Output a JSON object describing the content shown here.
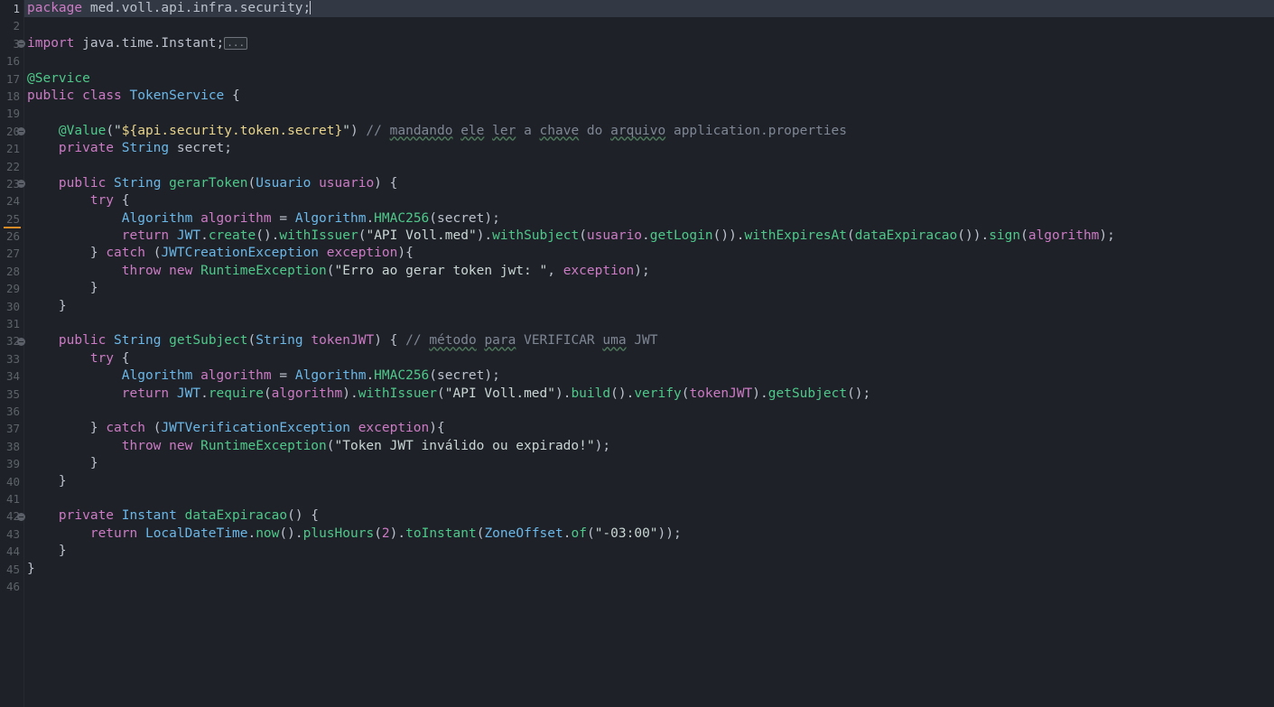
{
  "editor": {
    "language": "java",
    "file_type": "Java source",
    "background_color": "#1e2128",
    "current_line_color": "#323844",
    "gutter_color": "#1e2128",
    "marker_color": "#d98b26",
    "caret_color": "#c8ccd4",
    "first_visible_line": 1,
    "last_visible_line": 46,
    "current_line_number": 1,
    "fold_placeholder": "...",
    "fold_marker_lines": [
      3,
      20,
      23,
      32,
      42
    ],
    "marker_bar_line": 25
  },
  "lines": [
    {
      "num": "1",
      "current": true,
      "caret": true,
      "tokens": [
        {
          "t": "package",
          "c": "kw"
        },
        {
          "t": " med.voll.api.infra.security;",
          "c": "ns"
        }
      ]
    },
    {
      "num": "2",
      "tokens": []
    },
    {
      "num": "3",
      "fold": true,
      "foldbox": true,
      "tokens": [
        {
          "t": "import",
          "c": "kw"
        },
        {
          "t": " java.time.Instant;",
          "c": "ns"
        }
      ]
    },
    {
      "num": "16",
      "tokens": []
    },
    {
      "num": "17",
      "tokens": [
        {
          "t": "@Service",
          "c": "ann"
        }
      ]
    },
    {
      "num": "18",
      "tokens": [
        {
          "t": "public",
          "c": "kw"
        },
        {
          "t": " ",
          "c": "ns"
        },
        {
          "t": "class",
          "c": "kw"
        },
        {
          "t": " ",
          "c": "ns"
        },
        {
          "t": "TokenService",
          "c": "type"
        },
        {
          "t": " {",
          "c": "punc"
        }
      ]
    },
    {
      "num": "19",
      "tokens": []
    },
    {
      "num": "20",
      "fold": true,
      "tokens": [
        {
          "t": "    ",
          "c": "ns"
        },
        {
          "t": "@Value",
          "c": "ann"
        },
        {
          "t": "(",
          "c": "punc"
        },
        {
          "t": "\"",
          "c": "str"
        },
        {
          "t": "${api.security.token.secret}",
          "c": "tmpl"
        },
        {
          "t": "\"",
          "c": "str"
        },
        {
          "t": ") ",
          "c": "punc"
        },
        {
          "t": "// ",
          "c": "cmt"
        },
        {
          "t": "mandando",
          "c": "cmt sp"
        },
        {
          "t": " ",
          "c": "cmt"
        },
        {
          "t": "ele",
          "c": "cmt sp"
        },
        {
          "t": " ",
          "c": "cmt"
        },
        {
          "t": "ler",
          "c": "cmt sp"
        },
        {
          "t": " a ",
          "c": "cmt"
        },
        {
          "t": "chave",
          "c": "cmt sp"
        },
        {
          "t": " do ",
          "c": "cmt"
        },
        {
          "t": "arquivo",
          "c": "cmt sp"
        },
        {
          "t": " application.properties",
          "c": "cmt"
        }
      ]
    },
    {
      "num": "21",
      "tokens": [
        {
          "t": "    ",
          "c": "ns"
        },
        {
          "t": "private",
          "c": "kw"
        },
        {
          "t": " ",
          "c": "ns"
        },
        {
          "t": "String",
          "c": "type"
        },
        {
          "t": " ",
          "c": "ns"
        },
        {
          "t": "secret",
          "c": "ns"
        },
        {
          "t": ";",
          "c": "punc"
        }
      ]
    },
    {
      "num": "22",
      "tokens": []
    },
    {
      "num": "23",
      "fold": true,
      "tokens": [
        {
          "t": "    ",
          "c": "ns"
        },
        {
          "t": "public",
          "c": "kw"
        },
        {
          "t": " ",
          "c": "ns"
        },
        {
          "t": "String",
          "c": "type"
        },
        {
          "t": " ",
          "c": "ns"
        },
        {
          "t": "gerarToken",
          "c": "fn"
        },
        {
          "t": "(",
          "c": "punc"
        },
        {
          "t": "Usuario",
          "c": "type"
        },
        {
          "t": " ",
          "c": "ns"
        },
        {
          "t": "usuario",
          "c": "var"
        },
        {
          "t": ") {",
          "c": "punc"
        }
      ]
    },
    {
      "num": "24",
      "tokens": [
        {
          "t": "        ",
          "c": "ns"
        },
        {
          "t": "try",
          "c": "kw"
        },
        {
          "t": " {",
          "c": "punc"
        }
      ]
    },
    {
      "num": "25",
      "marker": true,
      "tokens": [
        {
          "t": "            ",
          "c": "ns"
        },
        {
          "t": "Algorithm",
          "c": "type"
        },
        {
          "t": " ",
          "c": "ns"
        },
        {
          "t": "algorithm",
          "c": "var"
        },
        {
          "t": " = ",
          "c": "punc"
        },
        {
          "t": "Algorithm",
          "c": "type"
        },
        {
          "t": ".",
          "c": "punc"
        },
        {
          "t": "HMAC256",
          "c": "fn"
        },
        {
          "t": "(",
          "c": "punc"
        },
        {
          "t": "secret",
          "c": "ns"
        },
        {
          "t": ");",
          "c": "punc"
        }
      ]
    },
    {
      "num": "26",
      "tokens": [
        {
          "t": "            ",
          "c": "ns"
        },
        {
          "t": "return",
          "c": "kw"
        },
        {
          "t": " ",
          "c": "ns"
        },
        {
          "t": "JWT",
          "c": "type"
        },
        {
          "t": ".",
          "c": "punc"
        },
        {
          "t": "create",
          "c": "fn"
        },
        {
          "t": "().",
          "c": "punc"
        },
        {
          "t": "withIssuer",
          "c": "fn"
        },
        {
          "t": "(",
          "c": "punc"
        },
        {
          "t": "\"API Voll.med\"",
          "c": "str"
        },
        {
          "t": ").",
          "c": "punc"
        },
        {
          "t": "withSubject",
          "c": "fn"
        },
        {
          "t": "(",
          "c": "punc"
        },
        {
          "t": "usuario",
          "c": "var"
        },
        {
          "t": ".",
          "c": "punc"
        },
        {
          "t": "getLogin",
          "c": "fn"
        },
        {
          "t": "()).",
          "c": "punc"
        },
        {
          "t": "withExpiresAt",
          "c": "fn"
        },
        {
          "t": "(",
          "c": "punc"
        },
        {
          "t": "dataExpiracao",
          "c": "fn"
        },
        {
          "t": "()).",
          "c": "punc"
        },
        {
          "t": "sign",
          "c": "fn"
        },
        {
          "t": "(",
          "c": "punc"
        },
        {
          "t": "algorithm",
          "c": "var"
        },
        {
          "t": ");",
          "c": "punc"
        }
      ]
    },
    {
      "num": "27",
      "tokens": [
        {
          "t": "        } ",
          "c": "punc"
        },
        {
          "t": "catch",
          "c": "kw"
        },
        {
          "t": " (",
          "c": "punc"
        },
        {
          "t": "JWTCreationException",
          "c": "type"
        },
        {
          "t": " ",
          "c": "ns"
        },
        {
          "t": "exception",
          "c": "var"
        },
        {
          "t": "){",
          "c": "punc"
        }
      ]
    },
    {
      "num": "28",
      "tokens": [
        {
          "t": "            ",
          "c": "ns"
        },
        {
          "t": "throw",
          "c": "kw"
        },
        {
          "t": " ",
          "c": "ns"
        },
        {
          "t": "new",
          "c": "kw"
        },
        {
          "t": " ",
          "c": "ns"
        },
        {
          "t": "RuntimeException",
          "c": "fn"
        },
        {
          "t": "(",
          "c": "punc"
        },
        {
          "t": "\"Erro ao gerar token jwt: \"",
          "c": "str"
        },
        {
          "t": ", ",
          "c": "punc"
        },
        {
          "t": "exception",
          "c": "var"
        },
        {
          "t": ");",
          "c": "punc"
        }
      ]
    },
    {
      "num": "29",
      "tokens": [
        {
          "t": "        }",
          "c": "punc"
        }
      ]
    },
    {
      "num": "30",
      "tokens": [
        {
          "t": "    }",
          "c": "punc"
        }
      ]
    },
    {
      "num": "31",
      "tokens": []
    },
    {
      "num": "32",
      "fold": true,
      "tokens": [
        {
          "t": "    ",
          "c": "ns"
        },
        {
          "t": "public",
          "c": "kw"
        },
        {
          "t": " ",
          "c": "ns"
        },
        {
          "t": "String",
          "c": "type"
        },
        {
          "t": " ",
          "c": "ns"
        },
        {
          "t": "getSubject",
          "c": "fn"
        },
        {
          "t": "(",
          "c": "punc"
        },
        {
          "t": "String",
          "c": "type"
        },
        {
          "t": " ",
          "c": "ns"
        },
        {
          "t": "tokenJWT",
          "c": "var"
        },
        {
          "t": ") { ",
          "c": "punc"
        },
        {
          "t": "// ",
          "c": "cmt"
        },
        {
          "t": "método",
          "c": "cmt sp"
        },
        {
          "t": " ",
          "c": "cmt"
        },
        {
          "t": "para",
          "c": "cmt sp"
        },
        {
          "t": " VERIFICAR ",
          "c": "cmt"
        },
        {
          "t": "uma",
          "c": "cmt sp"
        },
        {
          "t": " JWT",
          "c": "cmt"
        }
      ]
    },
    {
      "num": "33",
      "tokens": [
        {
          "t": "        ",
          "c": "ns"
        },
        {
          "t": "try",
          "c": "kw"
        },
        {
          "t": " {",
          "c": "punc"
        }
      ]
    },
    {
      "num": "34",
      "tokens": [
        {
          "t": "            ",
          "c": "ns"
        },
        {
          "t": "Algorithm",
          "c": "type"
        },
        {
          "t": " ",
          "c": "ns"
        },
        {
          "t": "algorithm",
          "c": "var"
        },
        {
          "t": " = ",
          "c": "punc"
        },
        {
          "t": "Algorithm",
          "c": "type"
        },
        {
          "t": ".",
          "c": "punc"
        },
        {
          "t": "HMAC256",
          "c": "fn"
        },
        {
          "t": "(",
          "c": "punc"
        },
        {
          "t": "secret",
          "c": "ns"
        },
        {
          "t": ");",
          "c": "punc"
        }
      ]
    },
    {
      "num": "35",
      "tokens": [
        {
          "t": "            ",
          "c": "ns"
        },
        {
          "t": "return",
          "c": "kw"
        },
        {
          "t": " ",
          "c": "ns"
        },
        {
          "t": "JWT",
          "c": "type"
        },
        {
          "t": ".",
          "c": "punc"
        },
        {
          "t": "require",
          "c": "fn"
        },
        {
          "t": "(",
          "c": "punc"
        },
        {
          "t": "algorithm",
          "c": "var"
        },
        {
          "t": ").",
          "c": "punc"
        },
        {
          "t": "withIssuer",
          "c": "fn"
        },
        {
          "t": "(",
          "c": "punc"
        },
        {
          "t": "\"API Voll.med\"",
          "c": "str"
        },
        {
          "t": ").",
          "c": "punc"
        },
        {
          "t": "build",
          "c": "fn"
        },
        {
          "t": "().",
          "c": "punc"
        },
        {
          "t": "verify",
          "c": "fn"
        },
        {
          "t": "(",
          "c": "punc"
        },
        {
          "t": "tokenJWT",
          "c": "var"
        },
        {
          "t": ").",
          "c": "punc"
        },
        {
          "t": "getSubject",
          "c": "fn"
        },
        {
          "t": "();",
          "c": "punc"
        }
      ]
    },
    {
      "num": "36",
      "tokens": []
    },
    {
      "num": "37",
      "tokens": [
        {
          "t": "        } ",
          "c": "punc"
        },
        {
          "t": "catch",
          "c": "kw"
        },
        {
          "t": " (",
          "c": "punc"
        },
        {
          "t": "JWTVerificationException",
          "c": "type"
        },
        {
          "t": " ",
          "c": "ns"
        },
        {
          "t": "exception",
          "c": "var"
        },
        {
          "t": "){",
          "c": "punc"
        }
      ]
    },
    {
      "num": "38",
      "tokens": [
        {
          "t": "            ",
          "c": "ns"
        },
        {
          "t": "throw",
          "c": "kw"
        },
        {
          "t": " ",
          "c": "ns"
        },
        {
          "t": "new",
          "c": "kw"
        },
        {
          "t": " ",
          "c": "ns"
        },
        {
          "t": "RuntimeException",
          "c": "fn"
        },
        {
          "t": "(",
          "c": "punc"
        },
        {
          "t": "\"Token JWT inválido ou expirado!\"",
          "c": "str"
        },
        {
          "t": ");",
          "c": "punc"
        }
      ]
    },
    {
      "num": "39",
      "tokens": [
        {
          "t": "        }",
          "c": "punc"
        }
      ]
    },
    {
      "num": "40",
      "tokens": [
        {
          "t": "    }",
          "c": "punc"
        }
      ]
    },
    {
      "num": "41",
      "tokens": []
    },
    {
      "num": "42",
      "fold": true,
      "tokens": [
        {
          "t": "    ",
          "c": "ns"
        },
        {
          "t": "private",
          "c": "kw"
        },
        {
          "t": " ",
          "c": "ns"
        },
        {
          "t": "Instant",
          "c": "type"
        },
        {
          "t": " ",
          "c": "ns"
        },
        {
          "t": "dataExpiracao",
          "c": "fn"
        },
        {
          "t": "() {",
          "c": "punc"
        }
      ]
    },
    {
      "num": "43",
      "tokens": [
        {
          "t": "        ",
          "c": "ns"
        },
        {
          "t": "return",
          "c": "kw"
        },
        {
          "t": " ",
          "c": "ns"
        },
        {
          "t": "LocalDateTime",
          "c": "type"
        },
        {
          "t": ".",
          "c": "punc"
        },
        {
          "t": "now",
          "c": "fn"
        },
        {
          "t": "().",
          "c": "punc"
        },
        {
          "t": "plusHours",
          "c": "fn"
        },
        {
          "t": "(",
          "c": "punc"
        },
        {
          "t": "2",
          "c": "num"
        },
        {
          "t": ").",
          "c": "punc"
        },
        {
          "t": "toInstant",
          "c": "fn"
        },
        {
          "t": "(",
          "c": "punc"
        },
        {
          "t": "ZoneOffset",
          "c": "type"
        },
        {
          "t": ".",
          "c": "punc"
        },
        {
          "t": "of",
          "c": "fn"
        },
        {
          "t": "(",
          "c": "punc"
        },
        {
          "t": "\"-03:00\"",
          "c": "str"
        },
        {
          "t": "));",
          "c": "punc"
        }
      ]
    },
    {
      "num": "44",
      "tokens": [
        {
          "t": "    }",
          "c": "punc"
        }
      ]
    },
    {
      "num": "45",
      "tokens": [
        {
          "t": "}",
          "c": "punc"
        }
      ]
    },
    {
      "num": "46",
      "tokens": []
    }
  ]
}
